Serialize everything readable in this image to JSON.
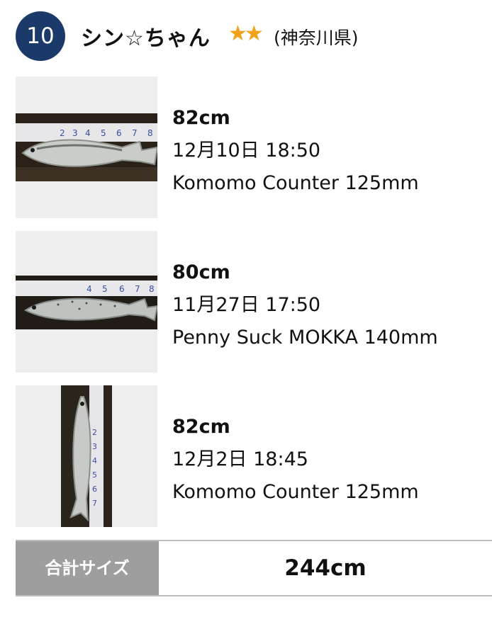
{
  "ranking": {
    "rank": "10",
    "user_name": "シン☆ちゃん",
    "stars": "★★",
    "prefecture": "(神奈川県)"
  },
  "catches": [
    {
      "size": "82cm",
      "date": "12月10日 18:50",
      "lure": "Komomo Counter 125mm",
      "photo": "fish-photo"
    },
    {
      "size": "80cm",
      "date": "11月27日 17:50",
      "lure": "Penny Suck MOKKA 140mm",
      "photo": "fish-photo"
    },
    {
      "size": "82cm",
      "date": "12月2日 18:45",
      "lure": "Komomo Counter 125mm",
      "photo": "fish-photo"
    }
  ],
  "total": {
    "label": "合計サイズ",
    "value": "244cm"
  },
  "colors": {
    "badge": "#1b3a69",
    "star": "#f0a21a",
    "total_label_bg": "#9e9e9e",
    "thumb_bg": "#eeeeee"
  }
}
